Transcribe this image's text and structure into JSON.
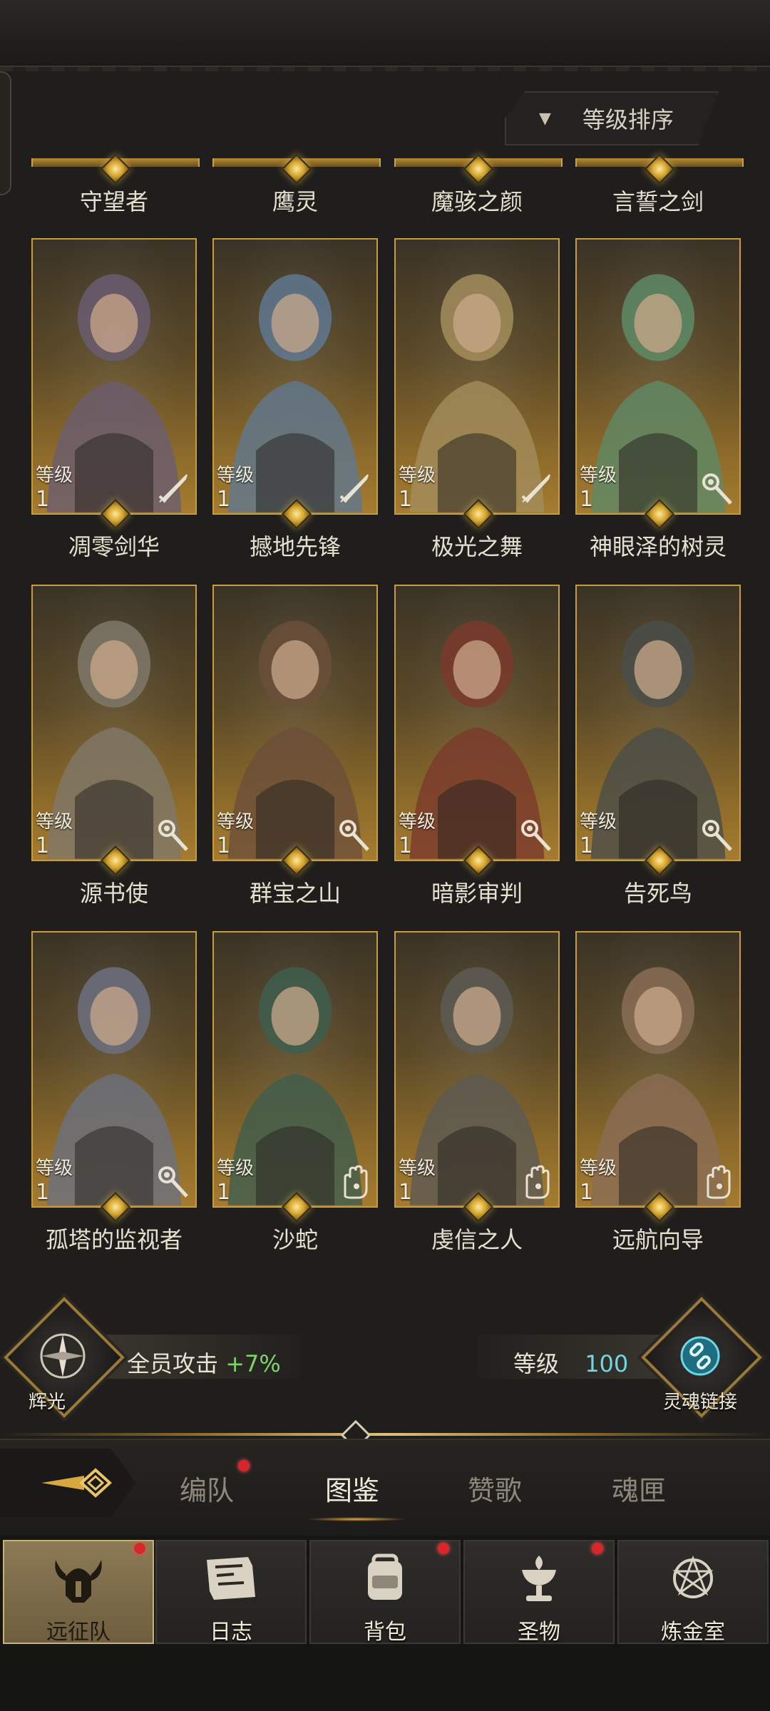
{
  "sort_button": {
    "label": "等级排序"
  },
  "previous_row_names": [
    "守望者",
    "鹰灵",
    "魔骇之颜",
    "言誓之剑"
  ],
  "heroes": [
    {
      "name": "凋零剑华",
      "level_label": "等级",
      "level": "1",
      "class_icon": "sword-icon"
    },
    {
      "name": "撼地先锋",
      "level_label": "等级",
      "level": "1",
      "class_icon": "sword-icon"
    },
    {
      "name": "极光之舞",
      "level_label": "等级",
      "level": "1",
      "class_icon": "sword-icon"
    },
    {
      "name": "神眼泽的树灵",
      "level_label": "等级",
      "level": "1",
      "class_icon": "magic-staff-icon"
    },
    {
      "name": "源书使",
      "level_label": "等级",
      "level": "1",
      "class_icon": "magic-staff-icon"
    },
    {
      "name": "群宝之山",
      "level_label": "等级",
      "level": "1",
      "class_icon": "magic-staff-icon"
    },
    {
      "name": "暗影审判",
      "level_label": "等级",
      "level": "1",
      "class_icon": "magic-staff-icon"
    },
    {
      "name": "告死鸟",
      "level_label": "等级",
      "level": "1",
      "class_icon": "magic-staff-icon"
    },
    {
      "name": "孤塔的监视者",
      "level_label": "等级",
      "level": "1",
      "class_icon": "magic-staff-icon"
    },
    {
      "name": "沙蛇",
      "level_label": "等级",
      "level": "1",
      "class_icon": "hand-icon"
    },
    {
      "name": "虔信之人",
      "level_label": "等级",
      "level": "1",
      "class_icon": "hand-icon"
    },
    {
      "name": "远航向导",
      "level_label": "等级",
      "level": "1",
      "class_icon": "hand-icon"
    }
  ],
  "bonus_bar": {
    "left_emblem_label": "辉光",
    "bonus_text": "全员攻击",
    "bonus_value": "+7%",
    "level_label": "等级",
    "level_value": "100",
    "right_emblem_label": "灵魂链接"
  },
  "tabs": [
    {
      "label": "编队",
      "badge": true
    },
    {
      "label": "图鉴",
      "badge": false,
      "active": true
    },
    {
      "label": "赞歌",
      "badge": false
    },
    {
      "label": "魂匣",
      "badge": false
    }
  ],
  "nav": [
    {
      "label": "远征队",
      "icon": "horned-helmet-icon",
      "badge": true,
      "active": true
    },
    {
      "label": "日志",
      "icon": "scroll-map-icon",
      "badge": false
    },
    {
      "label": "背包",
      "icon": "backpack-icon",
      "badge": true
    },
    {
      "label": "圣物",
      "icon": "chalice-icon",
      "badge": true
    },
    {
      "label": "炼金室",
      "icon": "alchemy-icon",
      "badge": false
    }
  ],
  "colors": {
    "gold": "#c99b3c",
    "bonus_green": "#7fd36b",
    "level_cyan": "#6fd6e6",
    "badge_red": "#d9262b"
  }
}
